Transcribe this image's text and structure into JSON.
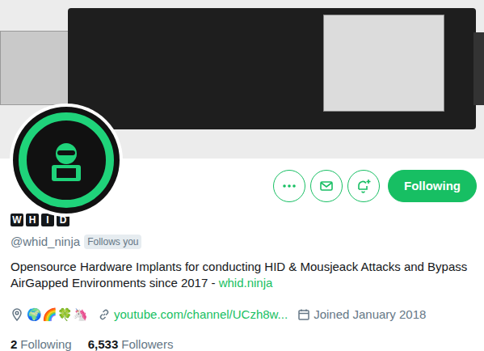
{
  "profile": {
    "name_letters": [
      "W",
      "H",
      "I",
      "D"
    ],
    "handle": "@whid_ninja",
    "follows_you": "Follows you",
    "bio": "Opensource Hardware Implants for conducting HID & Mousjeack Attacks and Bypass AirGapped Environments since 2017 - ",
    "bio_link": "whid.ninja",
    "location": "🌍🌈🍀🦄",
    "website": "youtube.com/channel/UCzh8w...",
    "joined": "Joined January 2018"
  },
  "follow_button": {
    "label": "Following",
    "following": true
  },
  "stats": [
    {
      "count": "2",
      "label": "Following"
    },
    {
      "count": "6,533",
      "label": "Followers"
    }
  ]
}
